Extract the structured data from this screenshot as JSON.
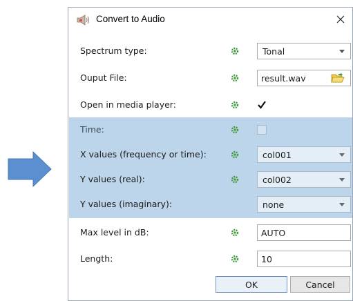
{
  "dialog": {
    "title": "Convert to Audio",
    "title_icon": "speaker-icon",
    "close_icon": "close-icon"
  },
  "rows": {
    "spectrum_type": {
      "label": "Spectrum type:",
      "value": "Tonal"
    },
    "output_file": {
      "label": "Ouput File:",
      "value": "result.wav"
    },
    "open_player": {
      "label": "Open in media player:",
      "checked": true
    },
    "time": {
      "label": "Time:",
      "checked": false
    },
    "x_values": {
      "label": "X values (frequency or time):",
      "value": "col001"
    },
    "y_real": {
      "label": "Y values (real):",
      "value": "col002"
    },
    "y_imag": {
      "label": "Y values (imaginary):",
      "value": "none"
    },
    "max_level": {
      "label": "Max level in dB:",
      "value": "AUTO"
    },
    "length": {
      "label": "Length:",
      "value": "10"
    }
  },
  "buttons": {
    "ok": "OK",
    "cancel": "Cancel"
  },
  "colors": {
    "accent_arrow": "#5b8fd0",
    "shaded_row": "#bdd5ea",
    "gear_green": "#3f9a3a"
  }
}
